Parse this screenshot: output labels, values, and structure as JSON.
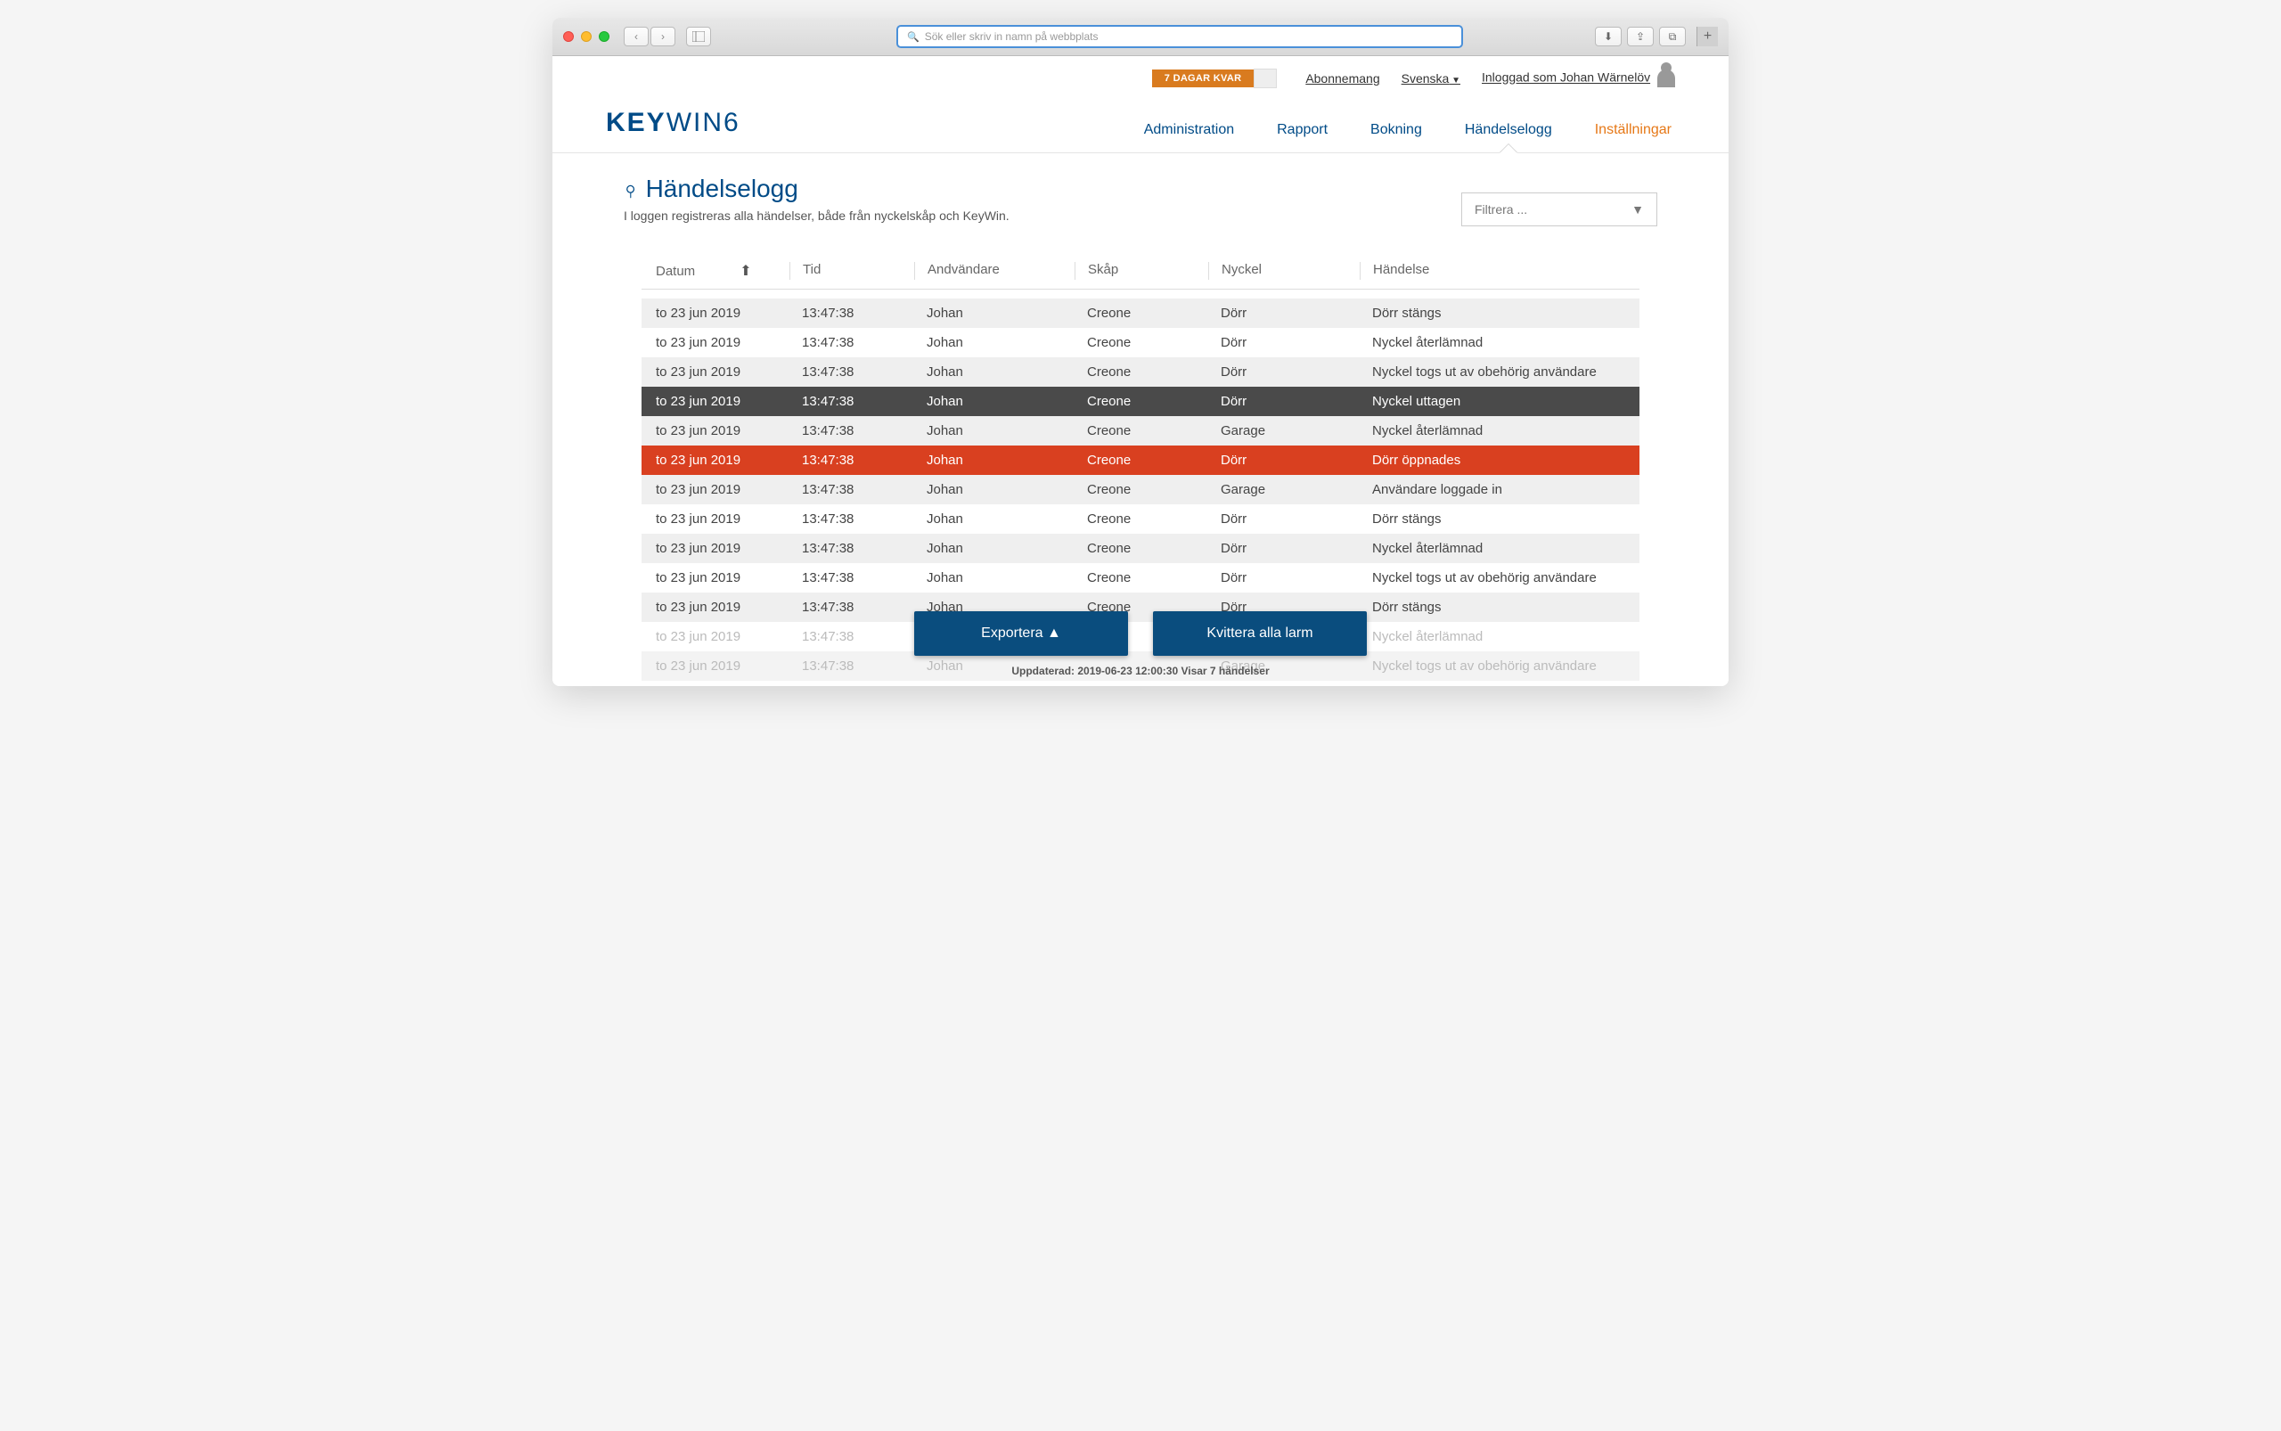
{
  "browser": {
    "url_placeholder": "Sök eller skriv in namn på webbplats"
  },
  "topbar": {
    "trial_text": "7 DAGAR KVAR",
    "subscription": "Abonnemang",
    "language": "Svenska",
    "logged_in": "Inloggad som Johan Wärnelöv"
  },
  "logo": {
    "bold": "KEY",
    "rest": "WIN6"
  },
  "nav": {
    "items": [
      "Administration",
      "Rapport",
      "Bokning",
      "Händelselogg",
      "Inställningar"
    ]
  },
  "page": {
    "title": "Händelselogg",
    "subtitle": "I loggen registreras alla händelser, både från nyckelskåp och KeyWin.",
    "filter_placeholder": "Filtrera ..."
  },
  "columns": {
    "date": "Datum",
    "time": "Tid",
    "user": "Andvändare",
    "cabinet": "Skåp",
    "key": "Nyckel",
    "event": "Händelse"
  },
  "rows": [
    {
      "date": "to 23 jun 2019",
      "time": "13:47:38",
      "user": "Johan",
      "cabinet": "Creone",
      "key": "Dörr",
      "event": "Dörr stängs",
      "style": "stripe"
    },
    {
      "date": "to 23 jun 2019",
      "time": "13:47:38",
      "user": "Johan",
      "cabinet": "Creone",
      "key": "Dörr",
      "event": "Nyckel återlämnad",
      "style": ""
    },
    {
      "date": "to 23 jun 2019",
      "time": "13:47:38",
      "user": "Johan",
      "cabinet": "Creone",
      "key": "Dörr",
      "event": "Nyckel togs ut av obehörig användare",
      "style": "stripe"
    },
    {
      "date": "to 23 jun 2019",
      "time": "13:47:38",
      "user": "Johan",
      "cabinet": "Creone",
      "key": "Dörr",
      "event": "Nyckel uttagen",
      "style": "dark"
    },
    {
      "date": "to 23 jun 2019",
      "time": "13:47:38",
      "user": "Johan",
      "cabinet": "Creone",
      "key": "Garage",
      "event": "Nyckel återlämnad",
      "style": "stripe"
    },
    {
      "date": "to 23 jun 2019",
      "time": "13:47:38",
      "user": "Johan",
      "cabinet": "Creone",
      "key": "Dörr",
      "event": "Dörr öppnades",
      "style": "red"
    },
    {
      "date": "to 23 jun 2019",
      "time": "13:47:38",
      "user": "Johan",
      "cabinet": "Creone",
      "key": "Garage",
      "event": "Användare loggade in",
      "style": "stripe"
    },
    {
      "date": "to 23 jun 2019",
      "time": "13:47:38",
      "user": "Johan",
      "cabinet": "Creone",
      "key": "Dörr",
      "event": "Dörr stängs",
      "style": ""
    },
    {
      "date": "to 23 jun 2019",
      "time": "13:47:38",
      "user": "Johan",
      "cabinet": "Creone",
      "key": "Dörr",
      "event": "Nyckel återlämnad",
      "style": "stripe"
    },
    {
      "date": "to 23 jun 2019",
      "time": "13:47:38",
      "user": "Johan",
      "cabinet": "Creone",
      "key": "Dörr",
      "event": "Nyckel togs ut av obehörig användare",
      "style": ""
    },
    {
      "date": "to 23 jun 2019",
      "time": "13:47:38",
      "user": "Johan",
      "cabinet": "Creone",
      "key": "Dörr",
      "event": "Dörr stängs",
      "style": "stripe"
    },
    {
      "date": "to 23 jun 2019",
      "time": "13:47:38",
      "user": "",
      "cabinet": "",
      "key": "",
      "event": "Nyckel återlämnad",
      "style": "faded"
    },
    {
      "date": "to 23 jun 2019",
      "time": "13:47:38",
      "user": "Johan",
      "cabinet": "",
      "key": "Garage",
      "event": "Nyckel togs ut av obehörig användare",
      "style": "faded stripe"
    }
  ],
  "actions": {
    "export": "Exportera ▲",
    "ack": "Kvittera alla larm"
  },
  "footer": "Uppdaterad: 2019-06-23 12:00:30 Visar 7 händelser"
}
